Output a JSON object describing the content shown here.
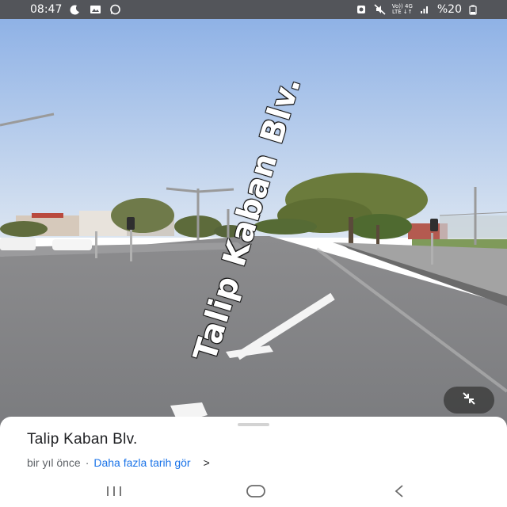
{
  "status_bar": {
    "time": "08:47",
    "battery": "%20",
    "network_top": "Vo)) 4G",
    "network_bottom": "LTE ↓↑",
    "left_icons": [
      "moon-icon",
      "image-icon",
      "whatsapp-icon"
    ],
    "right_icons": [
      "alarm-icon",
      "mute-icon",
      "network-icon",
      "signal-icon",
      "battery-icon"
    ]
  },
  "street_view": {
    "road_label": "Talip Kaban Blv.",
    "exit_icon": "exit-fullscreen-icon"
  },
  "place": {
    "title": "Talip Kaban Blv.",
    "date_text": "bir yıl önce",
    "separator": "·",
    "more_dates_link": "Daha fazla tarih gör",
    "chevron": ">"
  },
  "nav": {
    "recents": "recents-icon",
    "home": "home-icon",
    "back": "back-icon"
  }
}
